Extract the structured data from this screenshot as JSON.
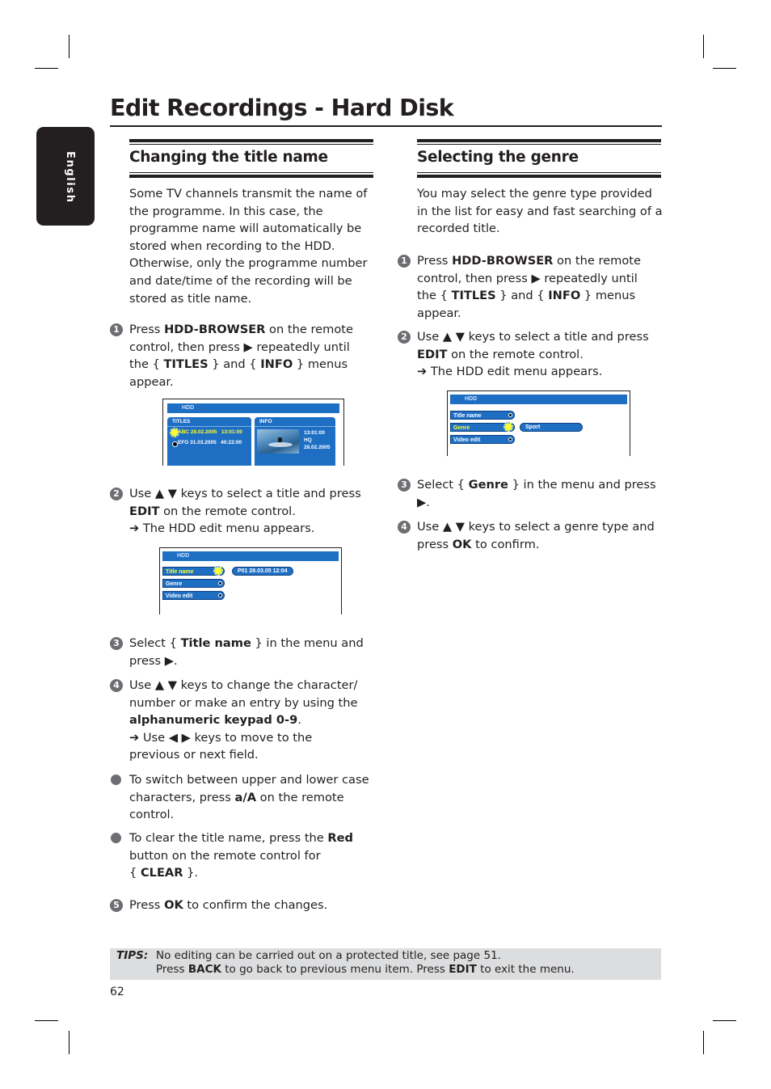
{
  "page_title": "Edit Recordings - Hard Disk",
  "language_tab": "English",
  "left": {
    "heading": "Changing the title name",
    "intro": [
      "Some TV channels transmit the name of",
      "the programme. In this case, the",
      "programme name will automatically be",
      "stored when recording to the HDD.",
      "Otherwise, only the programme number",
      "and date/time of the recording will be",
      "stored as title name."
    ],
    "step1": {
      "num": "1",
      "lines": [
        "Press <b>HDD-BROWSER</b> on the remote",
        "control, then press ▶ repeatedly until",
        "the { <b>TITLES</b> } and { <b>INFO</b> } menus",
        "appear."
      ]
    },
    "screen1": {
      "header": "HDD",
      "titles_label": "TITLES",
      "info_label": "INFO",
      "rows": [
        {
          "name": "ABC 28.02.2005",
          "time": "13:01:00",
          "selected": true
        },
        {
          "name": "EFG 31.03.2005",
          "time": "40:22:00",
          "selected": false
        }
      ],
      "info_lines": [
        "13:01:00",
        "HQ",
        "28.02.2005"
      ],
      "thumbnail": "surfer-image"
    },
    "step2": {
      "num": "2",
      "lines": [
        "Use ▲ ▼ keys to select a title and press",
        "<b>EDIT</b> on the remote control.",
        "➔ The HDD edit menu appears."
      ]
    },
    "screen2": {
      "header": "HDD",
      "menu": [
        "Title name",
        "Genre",
        "Video edit"
      ],
      "selected": "Title name",
      "value": "P01 28.03.05 12:04"
    },
    "step3": {
      "num": "3",
      "lines": [
        "Select { <b>Title name</b> } in the menu and",
        "press ▶."
      ]
    },
    "step4": {
      "num": "4",
      "lines": [
        "Use ▲ ▼ keys to change the character/",
        "number or make an entry by using the",
        "<b>alphanumeric keypad 0-9</b>.",
        "➔ Use ◀ ▶ keys to move to the",
        "previous or next field."
      ]
    },
    "bullet1": {
      "lines": [
        "To switch between upper and lower case",
        "characters, press <b>a/A</b> on the remote",
        "control."
      ]
    },
    "bullet2": {
      "lines": [
        "To clear the title name, press the <b>Red</b>",
        "button on the remote control for",
        "{ <b>CLEAR</b> }."
      ]
    },
    "step5": {
      "num": "5",
      "lines": [
        "Press <b>OK</b> to confirm the changes."
      ]
    }
  },
  "right": {
    "heading": "Selecting the genre",
    "intro": [
      "You may select the genre type provided",
      "in the list for easy and fast searching of a",
      "recorded title."
    ],
    "step1": {
      "num": "1",
      "lines": [
        "Press <b>HDD-BROWSER</b> on the remote",
        "control, then press ▶ repeatedly until",
        "the { <b>TITLES</b> } and { <b>INFO</b> } menus",
        "appear."
      ]
    },
    "step2": {
      "num": "2",
      "lines": [
        "Use ▲ ▼ keys to select a title and press",
        "<b>EDIT</b> on the remote control.",
        "➔ The HDD edit menu appears."
      ]
    },
    "screen": {
      "header": "HDD",
      "menu": [
        "Title name",
        "Genre",
        "Video edit"
      ],
      "selected": "Genre",
      "value": "Sport"
    },
    "step3": {
      "num": "3",
      "lines": [
        "Select { <b>Genre</b> } in the menu and press",
        "▶."
      ]
    },
    "step4": {
      "num": "4",
      "lines": [
        "Use ▲ ▼ keys to select a genre type and",
        "press <b>OK</b> to confirm."
      ]
    }
  },
  "tips": {
    "label": "TIPS:",
    "line1": "No editing can be carried out on a protected title, see page 51.",
    "line2": "Press <b>BACK</b> to go back to previous menu item. Press <b>EDIT</b> to exit the menu."
  },
  "page_number": "62",
  "colors": {
    "osd_blue": "#1e6fc4",
    "highlight_yellow": "#ffff33",
    "tips_bg": "#dcddde",
    "tab_bg": "#231f20"
  }
}
